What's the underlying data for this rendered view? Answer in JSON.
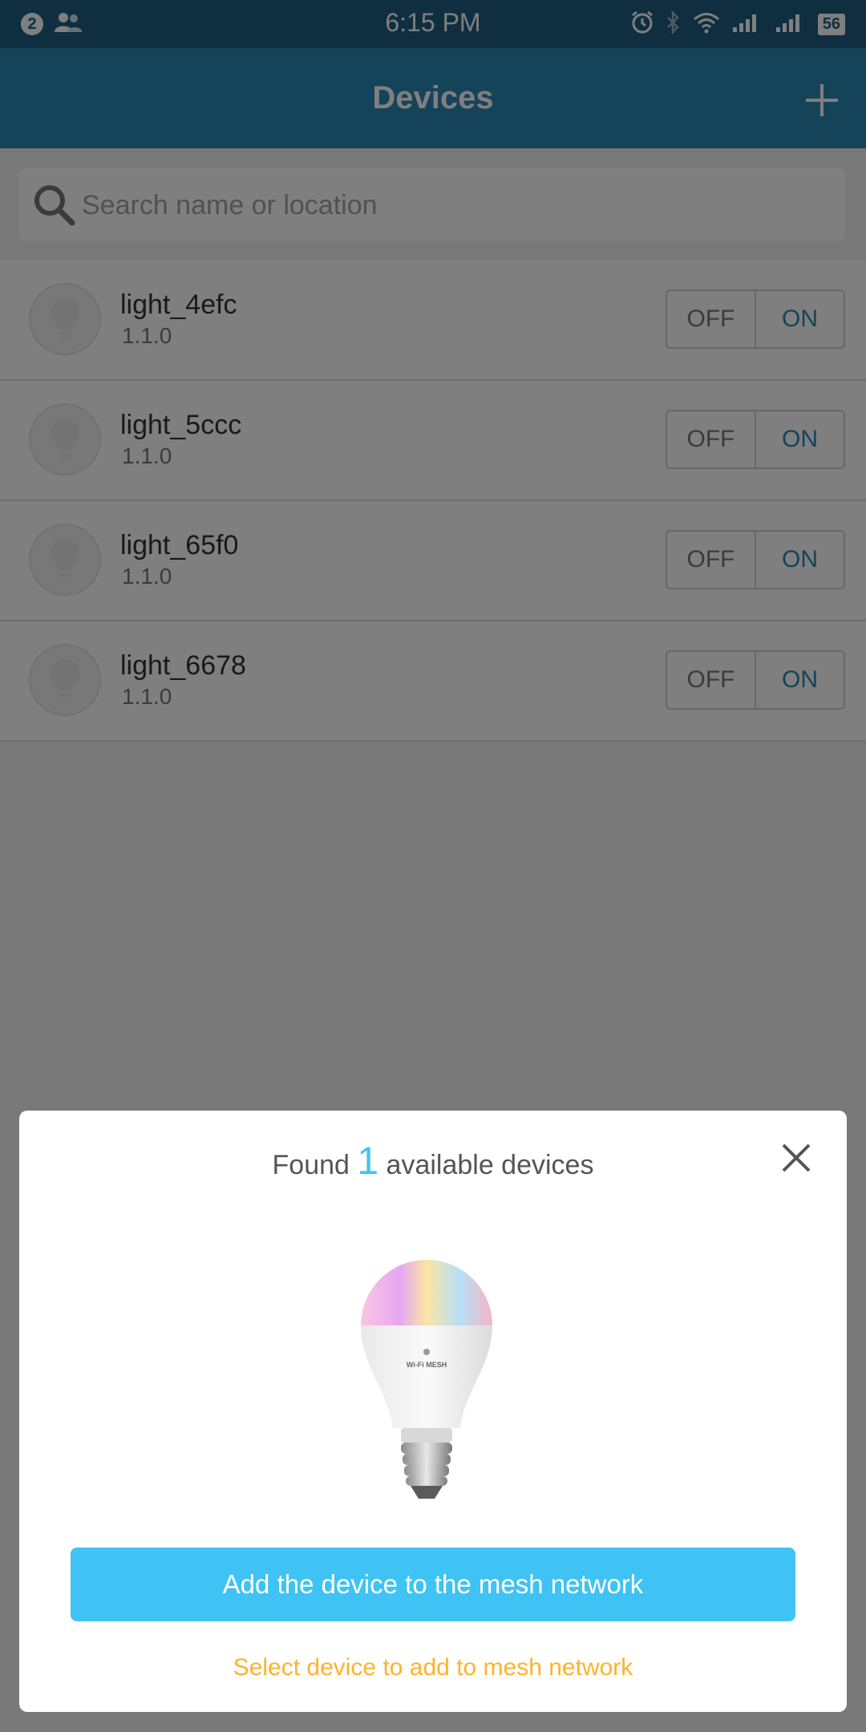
{
  "status_bar": {
    "notification_count": "2",
    "time": "6:15 PM",
    "battery": "56"
  },
  "app_bar": {
    "title": "Devices"
  },
  "search": {
    "placeholder": "Search name or location",
    "value": ""
  },
  "devices": [
    {
      "name": "light_4efc",
      "version": "1.1.0",
      "off_label": "OFF",
      "on_label": "ON"
    },
    {
      "name": "light_5ccc",
      "version": "1.1.0",
      "off_label": "OFF",
      "on_label": "ON"
    },
    {
      "name": "light_65f0",
      "version": "1.1.0",
      "off_label": "OFF",
      "on_label": "ON"
    },
    {
      "name": "light_6678",
      "version": "1.1.0",
      "off_label": "OFF",
      "on_label": "ON"
    }
  ],
  "dialog": {
    "title_prefix": "Found",
    "count": "1",
    "title_suffix": "available devices",
    "device_logo_text": "Wi-Fi MESH",
    "primary_button": "Add the device to the mesh network",
    "secondary_link": "Select device to add to mesh network"
  },
  "colors": {
    "status_bar": "#1f5f80",
    "app_bar": "#2b86b3",
    "accent": "#3ec3f4",
    "link": "#ffb22c"
  }
}
